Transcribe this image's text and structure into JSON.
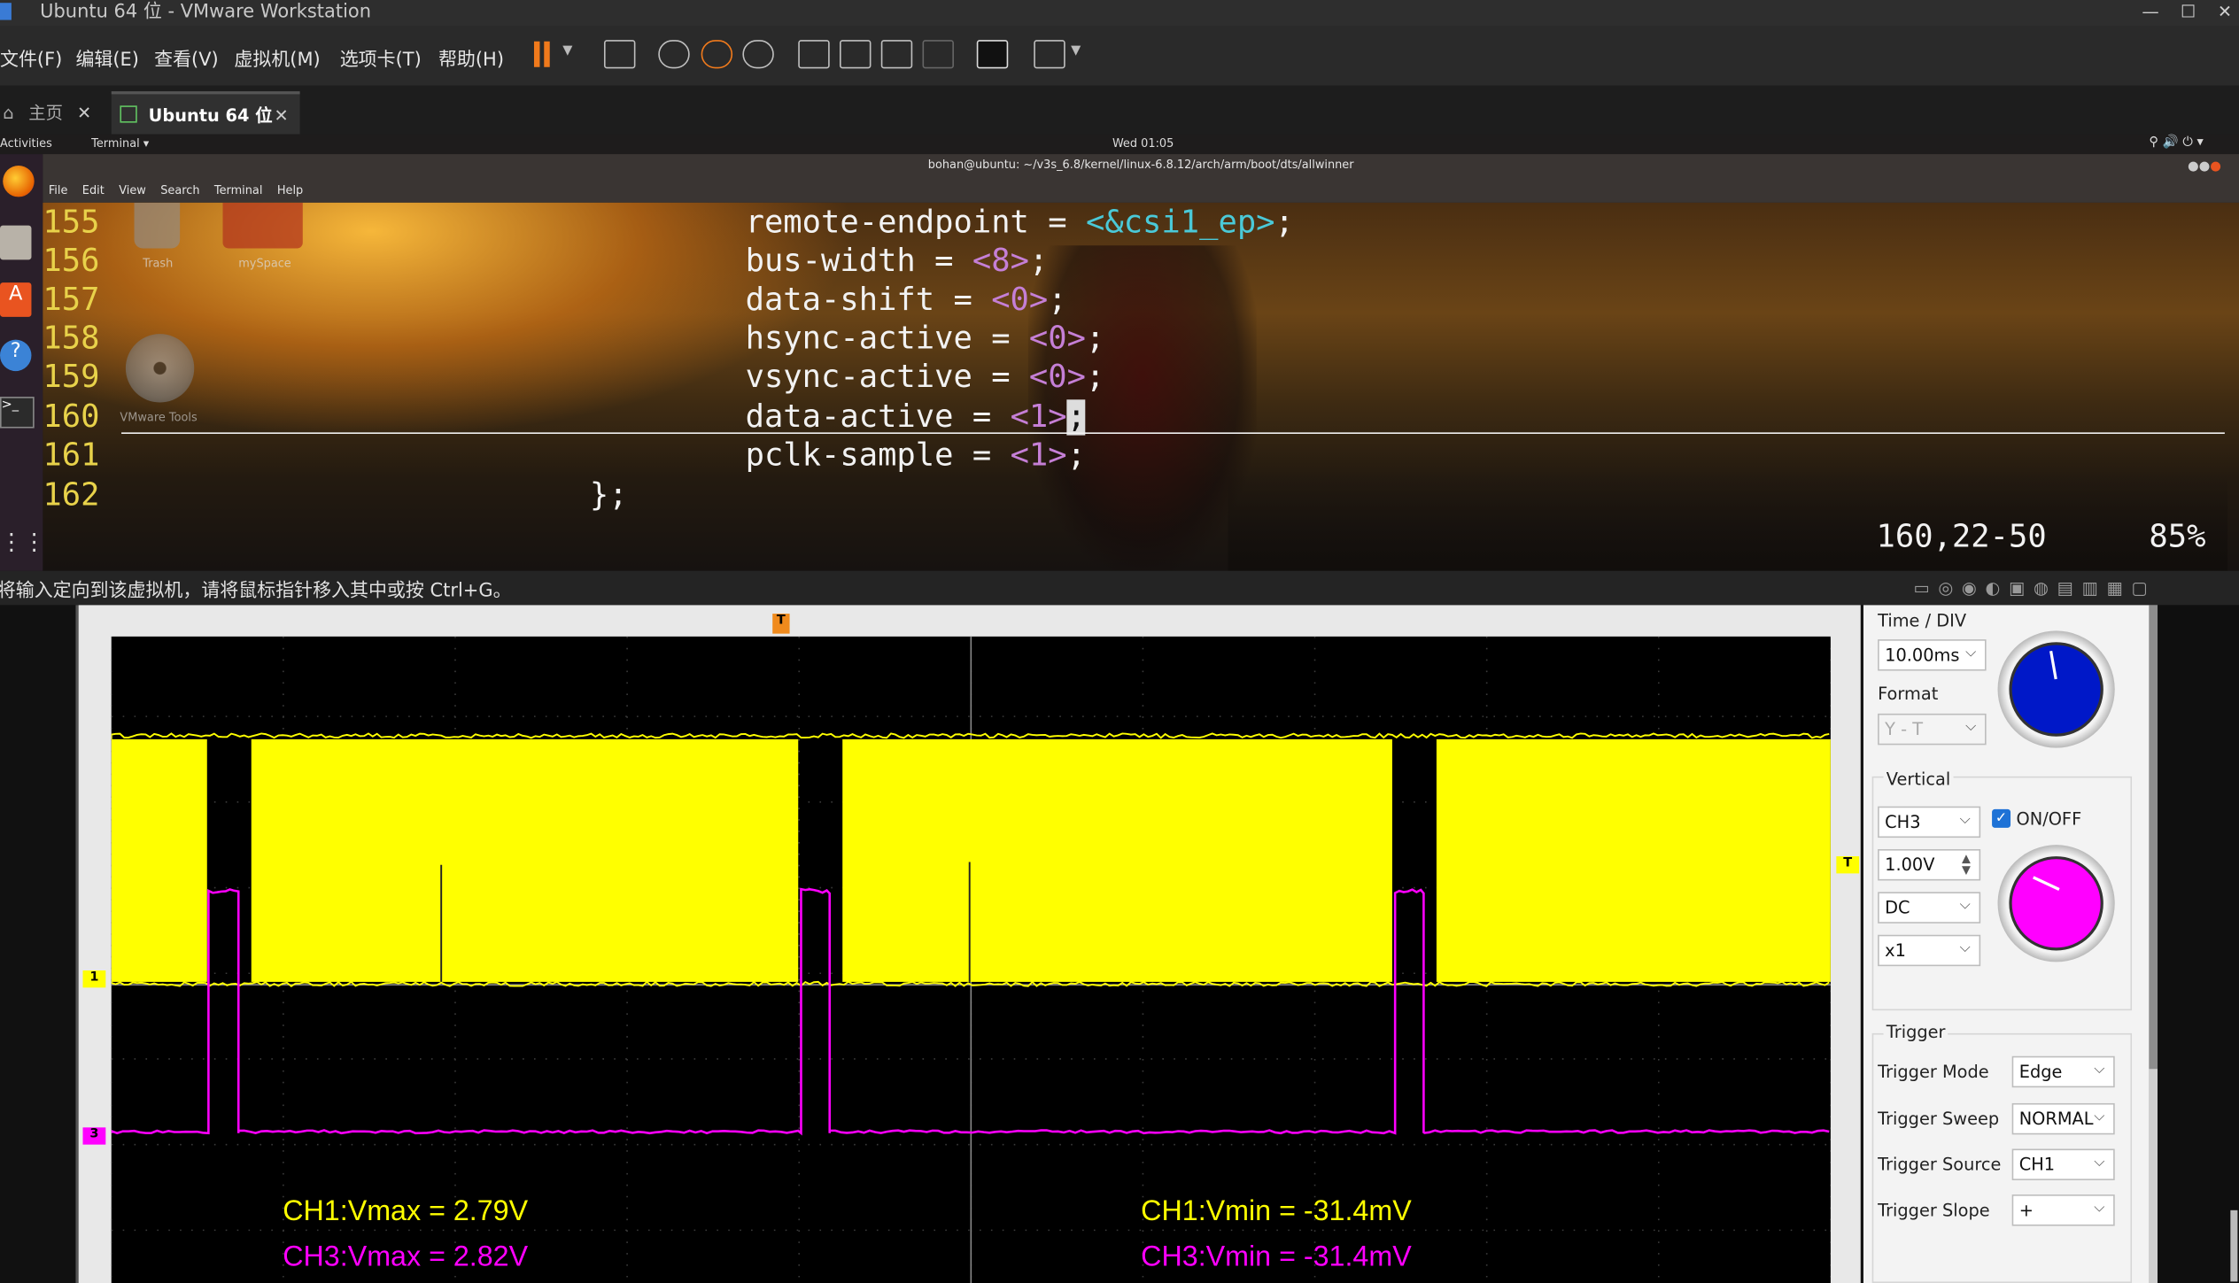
{
  "window": {
    "title": "Ubuntu 64 位 - VMware Workstation",
    "min_icon": "minimize-icon",
    "max_icon": "maximize-icon",
    "close_icon": "close-icon"
  },
  "menu": {
    "file": "文件(F)",
    "edit": "编辑(E)",
    "view": "查看(V)",
    "vm": "虚拟机(M)",
    "tabs": "选项卡(T)",
    "help": "帮助(H)"
  },
  "tabs": {
    "home": "主页",
    "vm": "Ubuntu 64 位"
  },
  "ubuntu": {
    "activities": "Activities",
    "app": "Terminal ▾",
    "clock": "Wed 01:05"
  },
  "terminal": {
    "title": "bohan@ubuntu: ~/v3s_6.8/kernel/linux-6.8.12/arch/arm/boot/dts/allwinner",
    "menu": [
      "File",
      "Edit",
      "View",
      "Search",
      "Terminal",
      "Help"
    ],
    "lines": [
      {
        "n": "155",
        "k": "remote-endpoint = ",
        "v": "<&csi1_ep>",
        "s": ";"
      },
      {
        "n": "156",
        "k": "bus-width = ",
        "v": "<8>",
        "s": ";"
      },
      {
        "n": "157",
        "k": "data-shift = ",
        "v": "<0>",
        "s": ";"
      },
      {
        "n": "158",
        "k": "hsync-active = ",
        "v": "<0>",
        "s": ";"
      },
      {
        "n": "159",
        "k": "vsync-active = ",
        "v": "<0>",
        "s": ";"
      },
      {
        "n": "160",
        "k": "data-active = ",
        "v": "<1>",
        "s": ";"
      },
      {
        "n": "161",
        "k": "pclk-sample = ",
        "v": "<1>",
        "s": ";"
      },
      {
        "n": "162",
        "k": "",
        "v": "",
        "s": "};"
      }
    ],
    "cursor_pos": "160,22-50",
    "percent": "85%",
    "desktop": {
      "trash": "Trash",
      "myspace": "mySpace",
      "vmware_tools": "VMware Tools"
    }
  },
  "status_message": "将输入定向到该虚拟机，请将鼠标指针移入其中或按 Ctrl+G。",
  "scope": {
    "markers": {
      "trigger_time": "T",
      "trigger_level": "T",
      "ch1": "1",
      "ch3": "3"
    },
    "measurements": {
      "ch1_vmax": "CH1:Vmax = 2.79V",
      "ch3_vmax": "CH3:Vmax = 2.82V",
      "ch1_vmin": "CH1:Vmin = -31.4mV",
      "ch3_vmin": "CH3:Vmin = -31.4mV"
    },
    "colors": {
      "ch1": "#ffff00",
      "ch3": "#ff00ff"
    }
  },
  "panel": {
    "time_div_label": "Time / DIV",
    "time_div_value": "10.00ms",
    "format_label": "Format",
    "format_value": "Y - T",
    "vertical_label": "Vertical",
    "channel_value": "CH3",
    "onoff_label": "ON/OFF",
    "volts_value": "1.00V",
    "coupling_value": "DC",
    "probe_value": "x1",
    "trigger_label": "Trigger",
    "trigger_mode_label": "Trigger Mode",
    "trigger_mode_value": "Edge",
    "trigger_sweep_label": "Trigger Sweep",
    "trigger_sweep_value": "NORMAL",
    "trigger_source_label": "Trigger Source",
    "trigger_source_value": "CH1",
    "trigger_slope_label": "Trigger Slope",
    "trigger_slope_value": "+"
  }
}
